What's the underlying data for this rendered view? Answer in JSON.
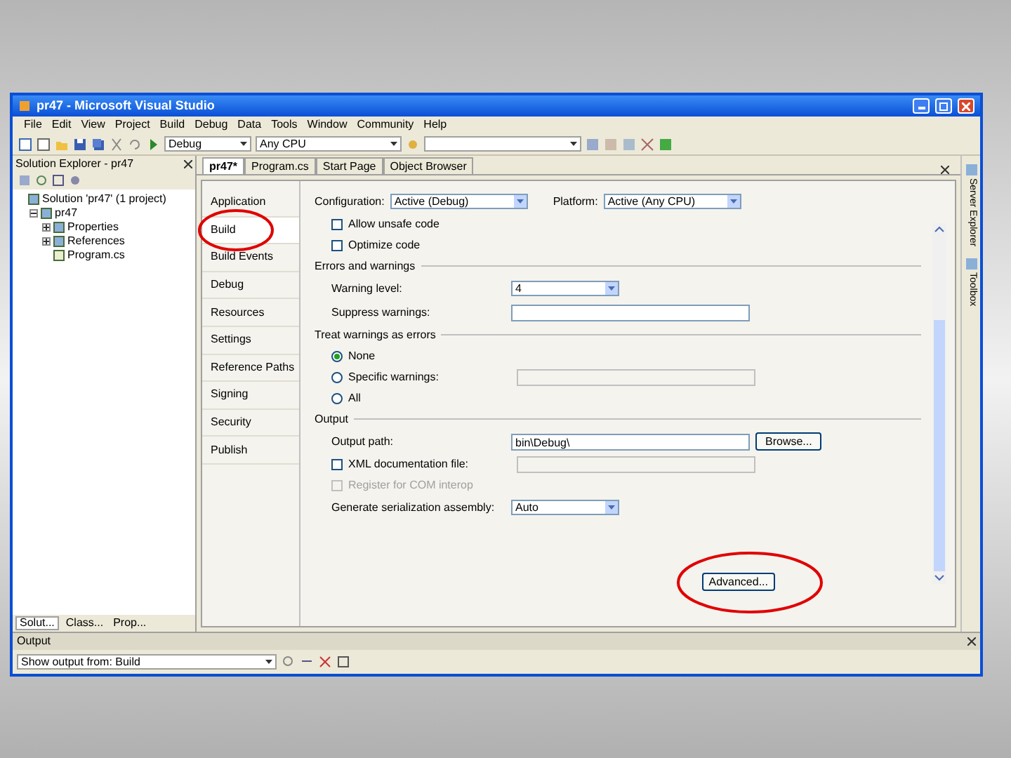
{
  "window": {
    "title": "pr47 - Microsoft Visual Studio"
  },
  "menu": [
    "File",
    "Edit",
    "View",
    "Project",
    "Build",
    "Debug",
    "Data",
    "Tools",
    "Window",
    "Community",
    "Help"
  ],
  "toolbar": {
    "configuration": "Debug",
    "platform": "Any CPU"
  },
  "solution_explorer": {
    "title": "Solution Explorer - pr47",
    "tree": [
      {
        "label": "Solution 'pr47' (1 project)",
        "children": [
          {
            "label": "pr47",
            "expanded": true,
            "children": [
              {
                "label": "Properties",
                "expanded": false
              },
              {
                "label": "References",
                "expanded": false
              },
              {
                "label": "Program.cs"
              }
            ]
          }
        ]
      }
    ],
    "bottom_tabs": [
      {
        "label": "Solut...",
        "selected": true
      },
      {
        "label": "Class...",
        "selected": false
      },
      {
        "label": "Prop...",
        "selected": false
      }
    ]
  },
  "document_tabs": [
    {
      "label": "pr47*",
      "selected": true
    },
    {
      "label": "Program.cs",
      "selected": false
    },
    {
      "label": "Start Page",
      "selected": false
    },
    {
      "label": "Object Browser",
      "selected": false
    }
  ],
  "property_tabs": [
    {
      "label": "Application",
      "selected": false
    },
    {
      "label": "Build",
      "selected": true
    },
    {
      "label": "Build Events",
      "selected": false
    },
    {
      "label": "Debug",
      "selected": false
    },
    {
      "label": "Resources",
      "selected": false
    },
    {
      "label": "Settings",
      "selected": false
    },
    {
      "label": "Reference Paths",
      "selected": false
    },
    {
      "label": "Signing",
      "selected": false
    },
    {
      "label": "Security",
      "selected": false
    },
    {
      "label": "Publish",
      "selected": false
    }
  ],
  "build_page": {
    "configuration_label": "Configuration:",
    "configuration": "Active (Debug)",
    "platform_label": "Platform:",
    "platform": "Active (Any CPU)",
    "general": [
      {
        "label": "Allow unsafe code",
        "checked": false,
        "disabled": false
      },
      {
        "label": "Optimize code",
        "checked": false,
        "disabled": false
      }
    ],
    "errors": {
      "heading": "Errors and warnings",
      "warning_level_label": "Warning level:",
      "warning_level": "4",
      "suppress_label": "Suppress warnings:"
    },
    "treat": {
      "heading": "Treat warnings as errors",
      "options": [
        {
          "label": "None",
          "selected": true
        },
        {
          "label": "Specific warnings:",
          "selected": false
        },
        {
          "label": "All",
          "selected": false
        }
      ]
    },
    "output": {
      "heading": "Output",
      "path_label": "Output path:",
      "path": "bin\\Debug\\",
      "browse": "Browse...",
      "checks": [
        {
          "label": "XML documentation file:",
          "checked": false,
          "disabled": false
        },
        {
          "label": "Register for COM interop",
          "checked": false,
          "disabled": true
        }
      ],
      "serialization_label": "Generate serialization assembly:",
      "serialization": "Auto"
    },
    "advanced": "Advanced..."
  },
  "side_strip": [
    "Server Explorer",
    "Toolbox"
  ],
  "output_panel": {
    "title": "Output",
    "show_from": "Show output from: Build"
  }
}
